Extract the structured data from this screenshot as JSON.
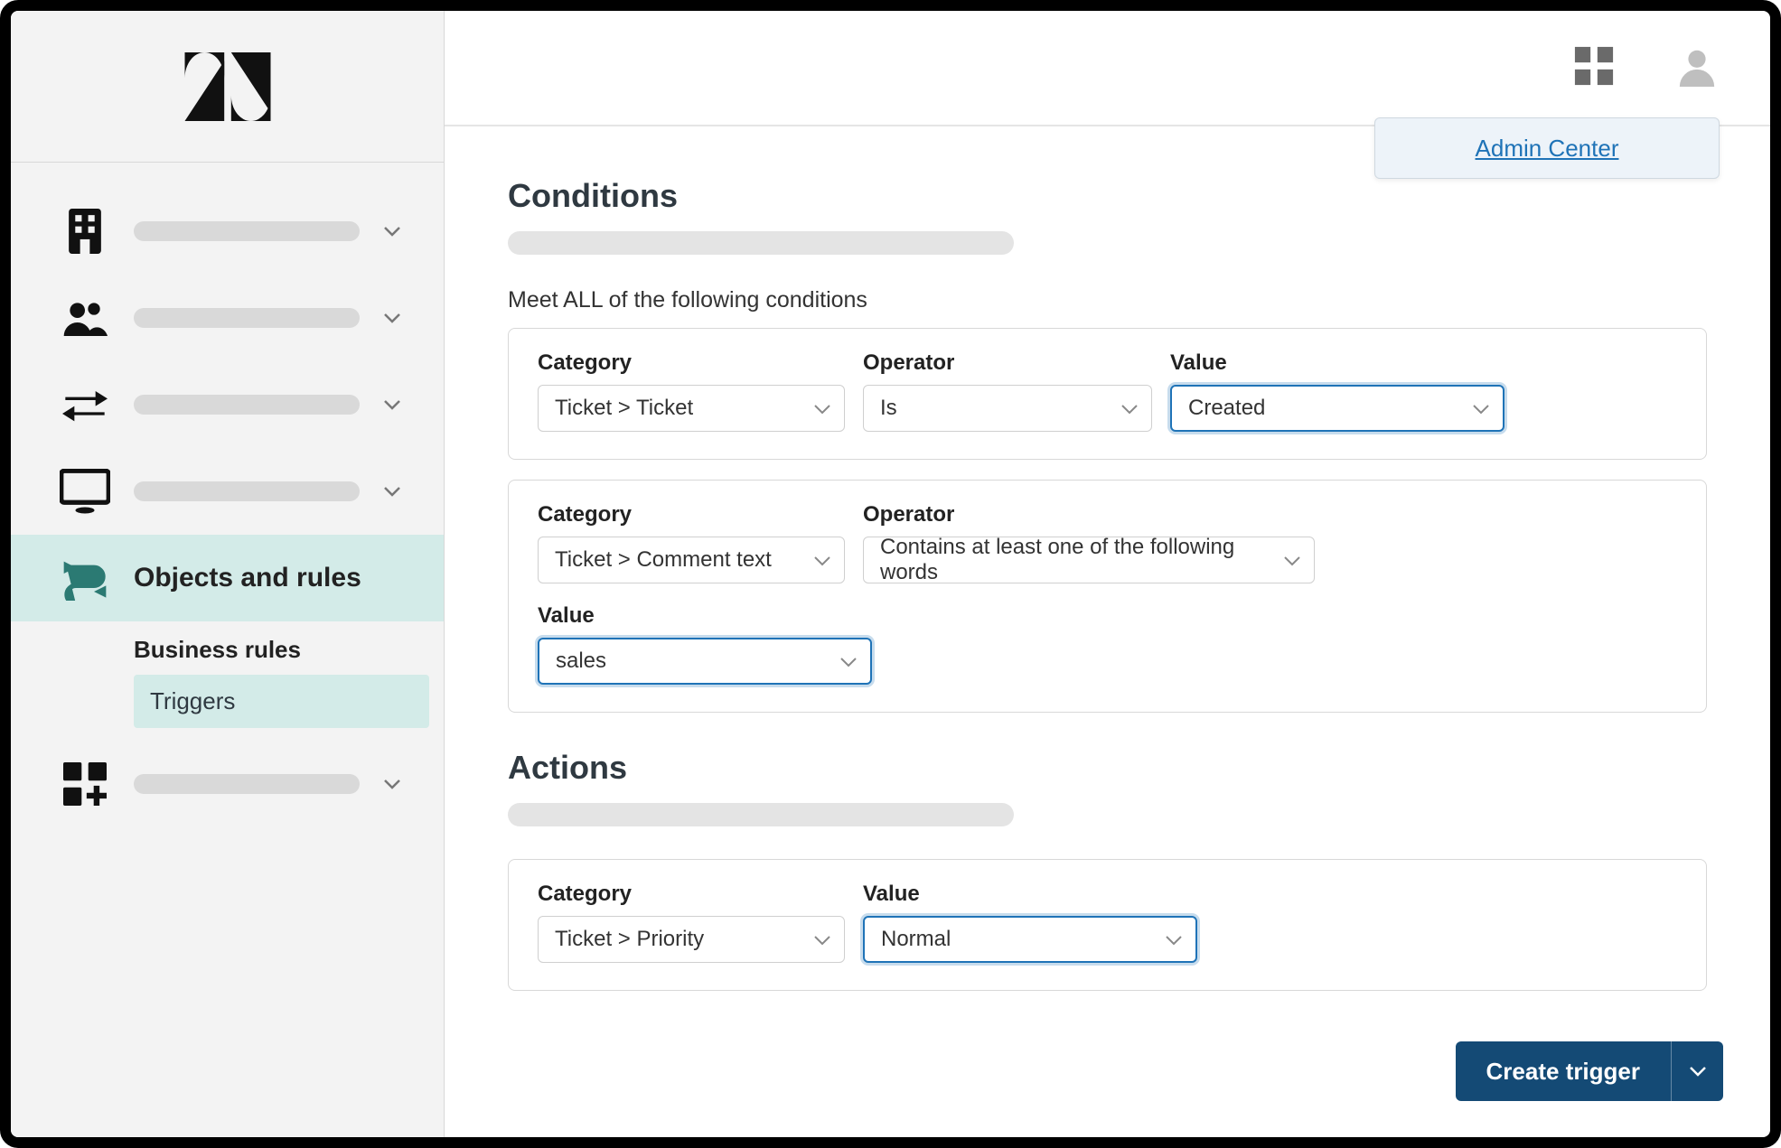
{
  "header": {
    "admin_center_label": "Admin Center"
  },
  "sidebar": {
    "active_label": "Objects and rules",
    "subnav_heading": "Business rules",
    "subnav_item": "Triggers"
  },
  "sections": {
    "conditions_title": "Conditions",
    "conditions_subhead": "Meet ALL of the following conditions",
    "actions_title": "Actions"
  },
  "labels": {
    "category": "Category",
    "operator": "Operator",
    "value": "Value"
  },
  "condition1": {
    "category": "Ticket > Ticket",
    "operator": "Is",
    "value": "Created"
  },
  "condition2": {
    "category": "Ticket > Comment text",
    "operator": "Contains at least one of the following words",
    "value": "sales"
  },
  "action1": {
    "category": "Ticket > Priority",
    "value": "Normal"
  },
  "footer": {
    "create_label": "Create trigger"
  }
}
